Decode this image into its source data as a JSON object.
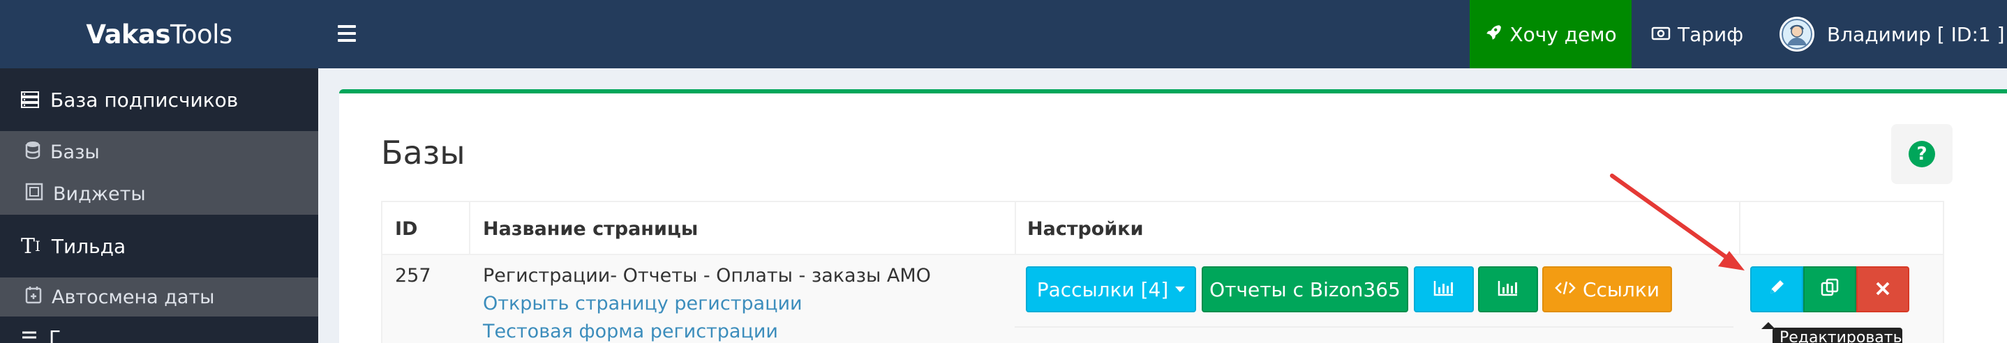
{
  "app": {
    "logo_bold": "Vakas",
    "logo_rest": "Tools"
  },
  "topbar": {
    "demo_label": "Хочу демо",
    "tariff_label": "Тариф",
    "user_label": "Владимир [ ID:1 ]"
  },
  "sidebar": {
    "section1": "База подписчиков",
    "items": [
      {
        "label": "Базы",
        "icon": "database-icon"
      },
      {
        "label": "Виджеты",
        "icon": "widget-icon"
      }
    ],
    "section2": "Тильда",
    "item_date": "Автосмена даты",
    "section3": "Г"
  },
  "page": {
    "title": "Базы",
    "help": "?"
  },
  "table": {
    "headers": [
      "ID",
      "Название страницы",
      "Настройки",
      ""
    ],
    "rows": [
      {
        "id": "257",
        "name": "Регистрации- Отчеты - Оплаты - заказы АМО",
        "link1": "Открыть страницу регистрации",
        "link2": "Тестовая форма регистрации",
        "btn_mailings": "Рассылки [4]",
        "btn_reports": "Отчеты с Bizon365",
        "btn_links": "Ссылки"
      }
    ]
  },
  "tooltip": "Редактировать",
  "colors": {
    "navbar": "#243c5c",
    "demo": "#008a00",
    "info": "#00c0ef",
    "success": "#00a65a",
    "warning": "#f39c12",
    "danger": "#dd4b39",
    "arrow": "#e53935"
  }
}
